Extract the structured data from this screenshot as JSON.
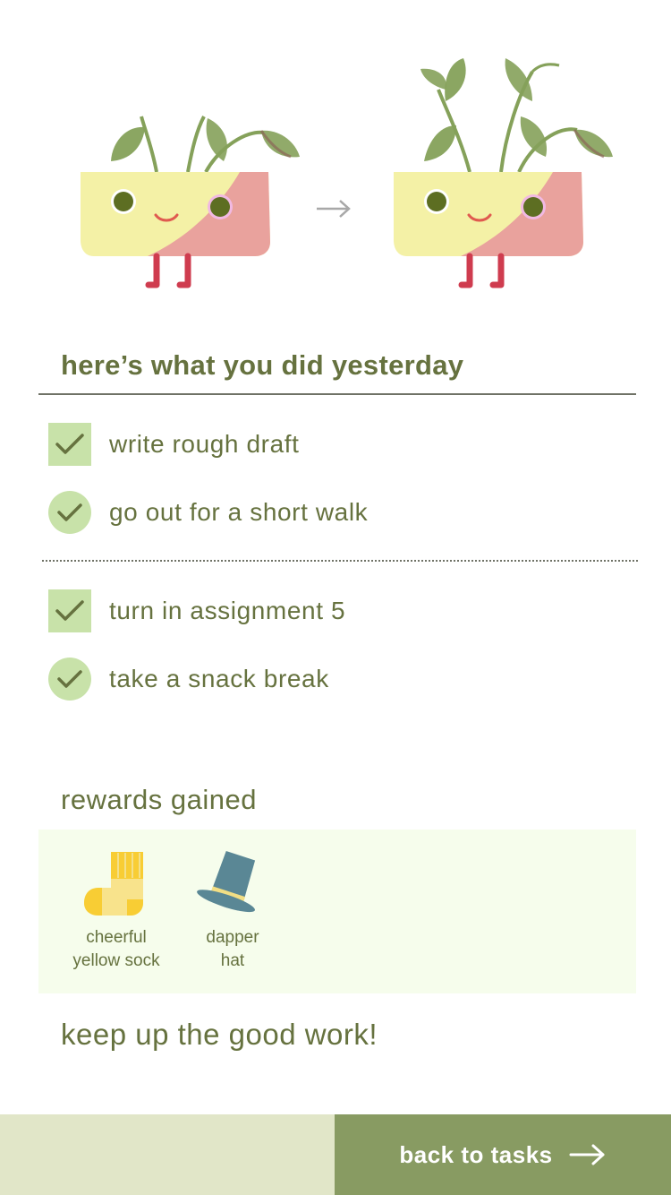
{
  "colors": {
    "text": "#66723f",
    "check_bg": "#c8e2a9",
    "rewards_bg": "#f6fdec",
    "button_bg": "#889b62",
    "footer_left_bg": "#e1e6c8",
    "pot_yellow": "#f4f1a6",
    "pot_pink": "#e9a29d",
    "leaf": "#85a15a",
    "legs": "#cf3c4f"
  },
  "hero": {
    "before_icon": "plant-pot-small-icon",
    "arrow_icon": "arrow-right-icon",
    "after_icon": "plant-pot-grown-icon"
  },
  "summary": {
    "title": "here’s what you did yesterday"
  },
  "tasks": [
    {
      "label": "write rough draft",
      "shape": "square"
    },
    {
      "label": "go out for a short walk",
      "shape": "circle"
    },
    {
      "label": "turn in assignment 5",
      "shape": "square"
    },
    {
      "label": "take a snack break",
      "shape": "circle"
    }
  ],
  "rewards": {
    "title": "rewards gained",
    "items": [
      {
        "name_line1": "cheerful",
        "name_line2": "yellow sock",
        "icon": "sock-icon"
      },
      {
        "name_line1": "dapper",
        "name_line2": "hat",
        "icon": "top-hat-icon"
      }
    ]
  },
  "encouragement": "keep up the good work!",
  "footer": {
    "button_label": "back to tasks",
    "button_icon": "arrow-right-icon"
  }
}
